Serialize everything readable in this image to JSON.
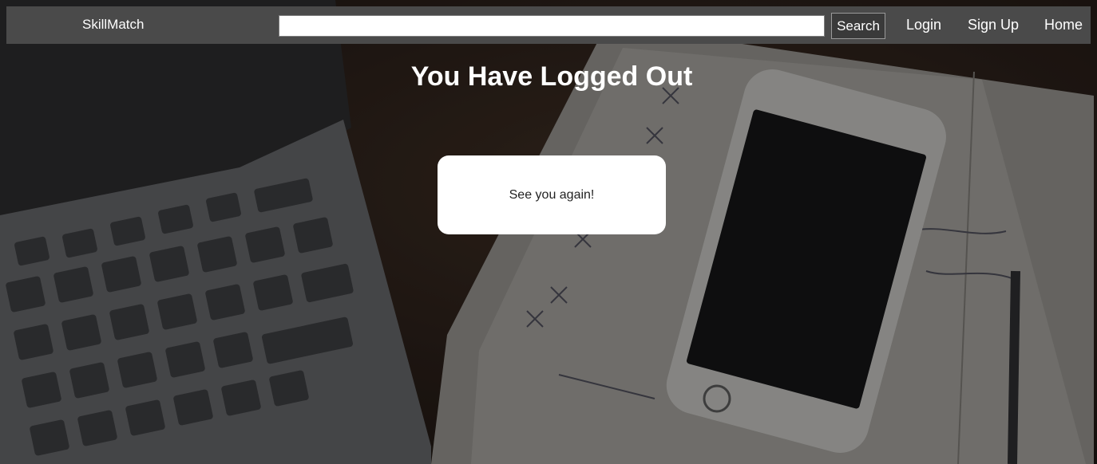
{
  "navbar": {
    "brand": "SkillMatch",
    "search": {
      "value": "",
      "placeholder": "",
      "button_label": "Search"
    },
    "links": {
      "login": "Login",
      "signup": "Sign Up",
      "home": "Home"
    }
  },
  "main": {
    "title": "You Have Logged Out",
    "message": "See you again!"
  },
  "colors": {
    "navbar_bg": "#4a4a4a",
    "card_bg": "#ffffff",
    "title_text": "#ffffff"
  },
  "background": {
    "icons": [
      "laptop-icon",
      "smartphone-icon",
      "notebook-icon",
      "pen-icon"
    ]
  }
}
